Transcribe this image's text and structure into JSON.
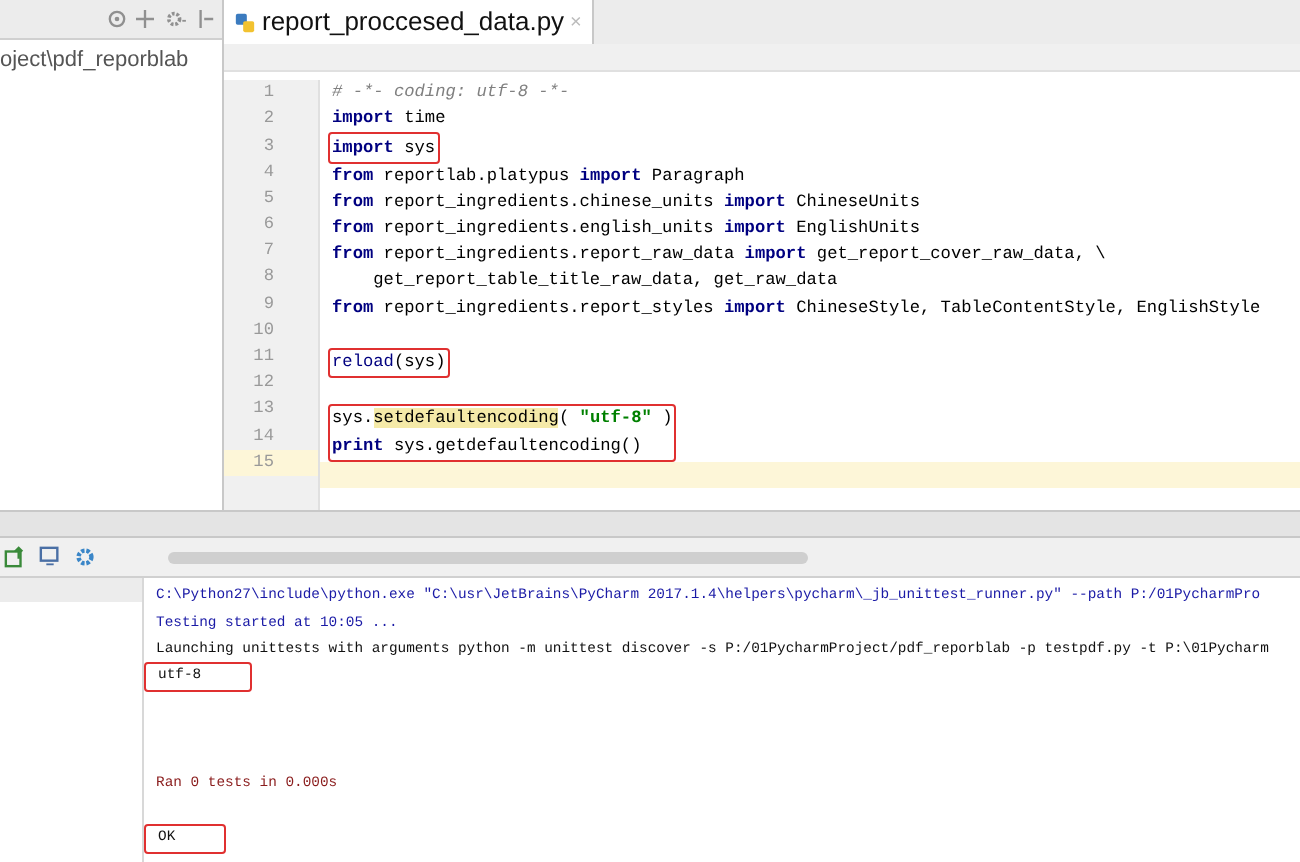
{
  "project_panel": {
    "path": "oject\\pdf_reporblab"
  },
  "tabs": [
    {
      "label": "report_proccesed_data.py",
      "selected": true,
      "close": "×"
    }
  ],
  "editor": {
    "lines": [
      {
        "number": "1",
        "boxed": false,
        "current": false,
        "tokens": [
          {
            "kind": "comment",
            "text": "# -*- coding: utf-8 -*-"
          }
        ]
      },
      {
        "number": "2",
        "boxed": false,
        "current": false,
        "tokens": [
          {
            "kind": "keyword",
            "text": "import"
          },
          {
            "kind": "plain",
            "text": " time"
          }
        ]
      },
      {
        "number": "3",
        "boxed": true,
        "current": false,
        "tokens": [
          {
            "kind": "keyword",
            "text": "import"
          },
          {
            "kind": "plain",
            "text": " sys"
          }
        ]
      },
      {
        "number": "4",
        "boxed": false,
        "current": false,
        "tokens": [
          {
            "kind": "keyword",
            "text": "from"
          },
          {
            "kind": "plain",
            "text": " reportlab.platypus "
          },
          {
            "kind": "keyword",
            "text": "import"
          },
          {
            "kind": "plain",
            "text": " Paragraph"
          }
        ]
      },
      {
        "number": "5",
        "boxed": false,
        "current": false,
        "tokens": [
          {
            "kind": "keyword",
            "text": "from"
          },
          {
            "kind": "plain",
            "text": " report_ingredients.chinese_units "
          },
          {
            "kind": "keyword",
            "text": "import"
          },
          {
            "kind": "plain",
            "text": " ChineseUnits"
          }
        ]
      },
      {
        "number": "6",
        "boxed": false,
        "current": false,
        "tokens": [
          {
            "kind": "keyword",
            "text": "from"
          },
          {
            "kind": "plain",
            "text": " report_ingredients.english_units "
          },
          {
            "kind": "keyword",
            "text": "import"
          },
          {
            "kind": "plain",
            "text": " EnglishUnits"
          }
        ]
      },
      {
        "number": "7",
        "boxed": false,
        "current": false,
        "tokens": [
          {
            "kind": "keyword",
            "text": "from"
          },
          {
            "kind": "plain",
            "text": " report_ingredients.report_raw_data "
          },
          {
            "kind": "keyword",
            "text": "import"
          },
          {
            "kind": "plain",
            "text": " get_report_cover_raw_data, \\"
          }
        ]
      },
      {
        "number": "8",
        "boxed": false,
        "current": false,
        "tokens": [
          {
            "kind": "plain",
            "text": "    get_report_table_title_raw_data, get_raw_data"
          }
        ]
      },
      {
        "number": "9",
        "boxed": false,
        "current": false,
        "tokens": [
          {
            "kind": "keyword",
            "text": "from"
          },
          {
            "kind": "plain",
            "text": " report_ingredients.report_styles "
          },
          {
            "kind": "keyword",
            "text": "import"
          },
          {
            "kind": "plain",
            "text": " ChineseStyle, TableContentStyle, EnglishStyle"
          }
        ]
      },
      {
        "number": "10",
        "boxed": false,
        "current": false
      },
      {
        "number": "11",
        "boxed": true,
        "current": false,
        "tokens": [
          {
            "kind": "builtin",
            "text": "reload"
          },
          {
            "kind": "plain",
            "text": "(sys)"
          }
        ]
      },
      {
        "number": "12",
        "boxed": false,
        "current": false
      },
      {
        "number": "13",
        "boxed": true,
        "current": false,
        "tokens": [
          {
            "kind": "plain",
            "text": "sys."
          },
          {
            "kind": "highlight",
            "text": "setdefaultencoding"
          },
          {
            "kind": "plain",
            "text": "( "
          },
          {
            "kind": "string",
            "text": "\"utf-8\""
          },
          {
            "kind": "plain",
            "text": " )"
          }
        ]
      },
      {
        "number": "14",
        "boxed": true,
        "current": false,
        "tokens": [
          {
            "kind": "keyword",
            "text": "print"
          },
          {
            "kind": "plain",
            "text": " sys.getdefaultencoding()"
          }
        ]
      },
      {
        "number": "15",
        "boxed": false,
        "current": true
      }
    ]
  },
  "console": {
    "lines": [
      {
        "kind": "info",
        "boxed": false,
        "text": "C:\\Python27\\include\\python.exe \"C:\\usr\\JetBrains\\PyCharm 2017.1.4\\helpers\\pycharm\\_jb_unittest_runner.py\" --path P:/01PycharmPro"
      },
      {
        "kind": "info",
        "boxed": false,
        "text": "Testing started at 10:05 ..."
      },
      {
        "kind": "normal",
        "boxed": false,
        "text": "Launching unittests with arguments python -m unittest discover -s P:/01PycharmProject/pdf_reporblab -p testpdf.py -t P:\\01Pycharm"
      },
      {
        "kind": "normal",
        "boxed": true,
        "text": "utf-8"
      },
      {
        "kind": "blank"
      },
      {
        "kind": "blank"
      },
      {
        "kind": "blank"
      },
      {
        "kind": "result",
        "boxed": false,
        "text": "Ran 0 tests in 0.000s"
      },
      {
        "kind": "blank"
      },
      {
        "kind": "normal",
        "boxed": true,
        "text": "OK"
      }
    ]
  }
}
